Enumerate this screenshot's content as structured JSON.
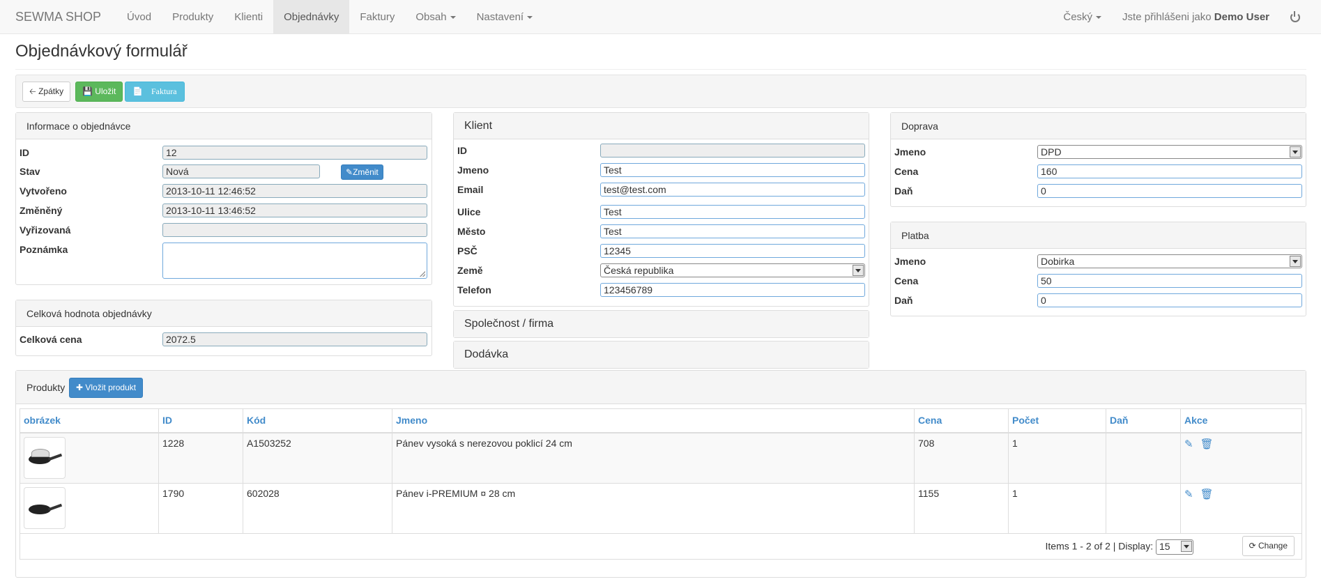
{
  "navbar": {
    "brand": "SEWMA SHOP",
    "items": [
      "Úvod",
      "Produkty",
      "Klienti",
      "Objednávky",
      "Faktury",
      "Obsah",
      "Nastavení"
    ],
    "language": "Český",
    "logged_in_prefix": "Jste přihlášeni jako",
    "user": "Demo User"
  },
  "page": {
    "title": "Objednávkový formulář"
  },
  "toolbar": {
    "back": "Zpátky",
    "save": "Uložit",
    "invoice": "Faktura"
  },
  "order_info": {
    "heading": "Informace o objednávce",
    "labels": {
      "id": "ID",
      "status": "Stav",
      "created": "Vytvořeno",
      "changed": "Změněný",
      "processed": "Vyřizovaná",
      "note": "Poznámka"
    },
    "values": {
      "id": "12",
      "status": "Nová",
      "created": "2013-10-11 12:46:52",
      "changed": "2013-10-11 13:46:52",
      "processed": "",
      "note": ""
    },
    "change_button": "Změnit"
  },
  "total": {
    "heading": "Celková hodnota objednávky",
    "label": "Celková cena",
    "value": "2072.5"
  },
  "client": {
    "heading": "Klient",
    "labels": {
      "id": "ID",
      "name": "Jmeno",
      "email": "Email",
      "street": "Ulice",
      "city": "Město",
      "zip": "PSČ",
      "country": "Země",
      "phone": "Telefon"
    },
    "values": {
      "id": "",
      "name": "Test",
      "email": "test@test.com",
      "street": "Test",
      "city": "Test",
      "zip": "12345",
      "country": "Česká republika",
      "phone": "123456789"
    },
    "company_heading": "Společnost / firma",
    "delivery_heading": "Dodávka"
  },
  "shipping": {
    "heading": "Doprava",
    "labels": {
      "name": "Jmeno",
      "price": "Cena",
      "tax": "Daň"
    },
    "values": {
      "name": "DPD",
      "price": "160",
      "tax": "0"
    }
  },
  "payment": {
    "heading": "Platba",
    "labels": {
      "name": "Jmeno",
      "price": "Cena",
      "tax": "Daň"
    },
    "values": {
      "name": "Dobirka",
      "price": "50",
      "tax": "0"
    }
  },
  "products": {
    "heading": "Produkty",
    "add_button": "Vložit produkt",
    "columns": [
      "obrázek",
      "ID",
      "Kód",
      "Jmeno",
      "Cena",
      "Počet",
      "Daň",
      "Akce"
    ],
    "rows": [
      {
        "id": "1228",
        "code": "A1503252",
        "name": "Pánev vysoká s nerezovou poklicí 24 cm",
        "price": "708",
        "qty": "1",
        "tax": ""
      },
      {
        "id": "1790",
        "code": "602028",
        "name": "Pánev i-PREMIUM ¤ 28 cm",
        "price": "1155",
        "qty": "1",
        "tax": ""
      }
    ],
    "pager_text": "Items 1 - 2 of 2 | Display:",
    "display_value": "15",
    "change_button": "Change"
  }
}
